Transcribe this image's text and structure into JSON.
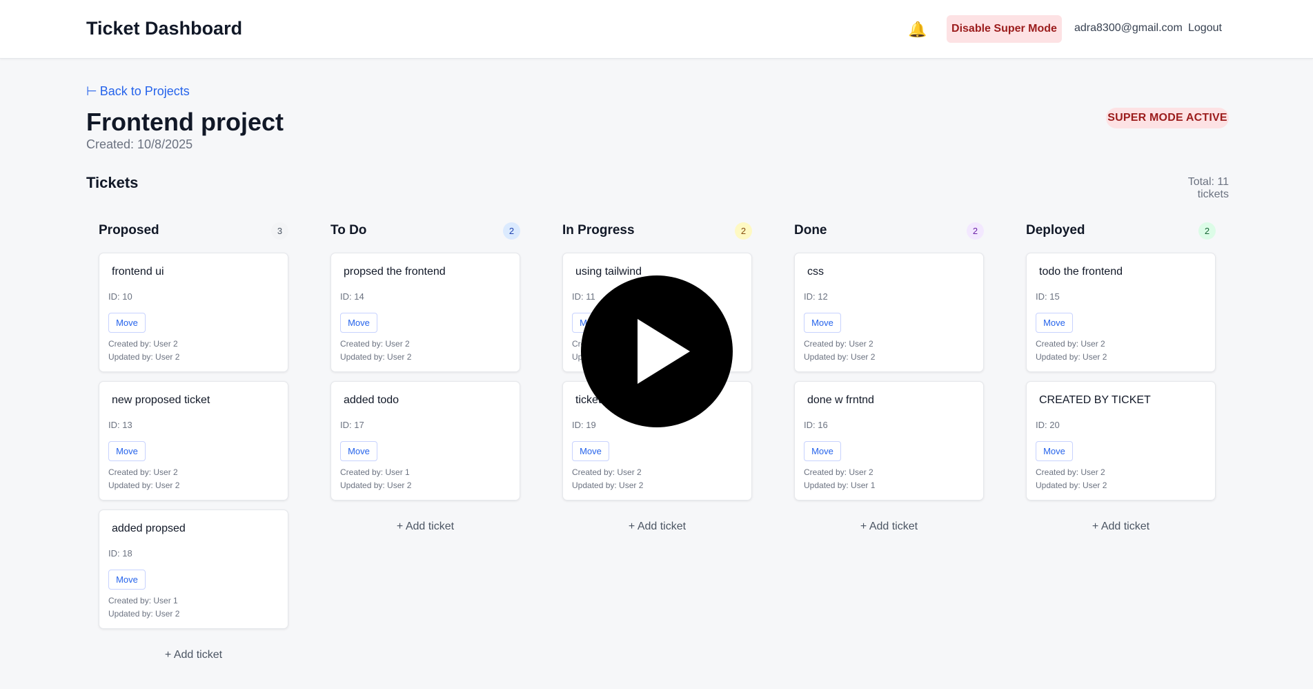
{
  "header": {
    "title": "Ticket Dashboard",
    "bell_icon": "bell-icon",
    "super_mode_button": "Disable Super Mode",
    "user_email": "adra8300@gmail.com",
    "logout": "Logout"
  },
  "project": {
    "back_link": "Back to Projects",
    "back_arrow": "⊢",
    "name": "Frontend project",
    "created": "Created: 10/8/2025",
    "badge": "SUPER MODE ACTIVE"
  },
  "tickets": {
    "heading": "Tickets",
    "total": "Total: 11 tickets",
    "add_label": "+ Add ticket",
    "move_label": "Move"
  },
  "columns": [
    {
      "title": "Proposed",
      "count": "3",
      "count_bg": "#f3f4f6",
      "count_fg": "#4b5563",
      "cards": [
        {
          "title": "frontend ui",
          "id": "ID: 10",
          "created": "Created by: User 2",
          "updated": "Updated by: User 2"
        },
        {
          "title": "new proposed ticket",
          "id": "ID: 13",
          "created": "Created by: User 2",
          "updated": "Updated by: User 2"
        },
        {
          "title": "added propsed",
          "id": "ID: 18",
          "created": "Created by: User 1",
          "updated": "Updated by: User 2"
        }
      ]
    },
    {
      "title": "To Do",
      "count": "2",
      "count_bg": "#dbeafe",
      "count_fg": "#1e40af",
      "cards": [
        {
          "title": "propsed the frontend",
          "id": "ID: 14",
          "created": "Created by: User 2",
          "updated": "Updated by: User 2"
        },
        {
          "title": "added todo",
          "id": "ID: 17",
          "created": "Created by: User 1",
          "updated": "Updated by: User 2"
        }
      ]
    },
    {
      "title": "In Progress",
      "count": "2",
      "count_bg": "#fef9c3",
      "count_fg": "#854d0e",
      "cards": [
        {
          "title": "using tailwind",
          "id": "ID: 11",
          "created": "Created by: User 2",
          "updated": "Updated by: adra59ranjan@"
        },
        {
          "title": "ticket",
          "id": "ID: 19",
          "created": "Created by: User 2",
          "updated": "Updated by: User 2"
        }
      ]
    },
    {
      "title": "Done",
      "count": "2",
      "count_bg": "#f3e8ff",
      "count_fg": "#6b21a8",
      "cards": [
        {
          "title": "css",
          "id": "ID: 12",
          "created": "Created by: User 2",
          "updated": "Updated by: User 2"
        },
        {
          "title": "done w frntnd",
          "id": "ID: 16",
          "created": "Created by: User 2",
          "updated": "Updated by: User 1"
        }
      ]
    },
    {
      "title": "Deployed",
      "count": "2",
      "count_bg": "#dcfce7",
      "count_fg": "#166534",
      "cards": [
        {
          "title": "todo the frontend",
          "id": "ID: 15",
          "created": "Created by: User 2",
          "updated": "Updated by: User 2"
        },
        {
          "title": "CREATED BY TICKET",
          "id": "ID: 20",
          "created": "Created by: User 2",
          "updated": "Updated by: User 2"
        }
      ]
    }
  ],
  "overlay": {
    "icon": "play-icon"
  }
}
